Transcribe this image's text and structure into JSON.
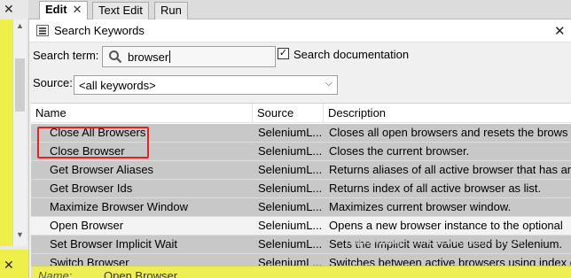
{
  "tabs": [
    {
      "label": "Edit",
      "active": true
    },
    {
      "label": "Text Edit",
      "active": false
    },
    {
      "label": "Run",
      "active": false
    }
  ],
  "dialog": {
    "title": "Search Keywords",
    "search_label": "Search term:",
    "search_value": "browser",
    "search_doc_label": "Search documentation",
    "search_doc_checked": true,
    "source_label": "Source:",
    "source_value": "<all keywords>"
  },
  "table": {
    "headers": [
      "Name",
      "Source",
      "Description"
    ],
    "rows": [
      {
        "name": "Close All Browsers",
        "source": "SeleniumL...",
        "description": "Closes all open browsers and resets the brows"
      },
      {
        "name": "Close Browser",
        "source": "SeleniumL...",
        "description": "Closes the current browser."
      },
      {
        "name": "Get Browser Aliases",
        "source": "SeleniumL...",
        "description": "Returns aliases of all active browser that has an"
      },
      {
        "name": "Get Browser Ids",
        "source": "SeleniumL...",
        "description": "Returns index of all active browser as list."
      },
      {
        "name": "Maximize Browser Window",
        "source": "SeleniumL...",
        "description": "Maximizes current browser window."
      },
      {
        "name": "Open Browser",
        "source": "SeleniumL...",
        "description": "Opens a new browser instance to the optional"
      },
      {
        "name": "Set Browser Implicit Wait",
        "source": "SeleniumL...",
        "description": "Sets the implicit wait value used by Selenium."
      },
      {
        "name": "Switch Browser",
        "source": "SeleniumL...",
        "description": "Switches between active browsers using index o"
      }
    ],
    "selected_index": 5
  },
  "doc": {
    "name_label": "Name:",
    "name_value": "Open Browser"
  },
  "watermark": "https://blog.csdn.net/qq_36248609",
  "colors": {
    "row_bg": "#c8c8c8",
    "selected_bg": "#f3f3f3",
    "highlight": "#e32222",
    "side_yellow": "#efef4a"
  }
}
